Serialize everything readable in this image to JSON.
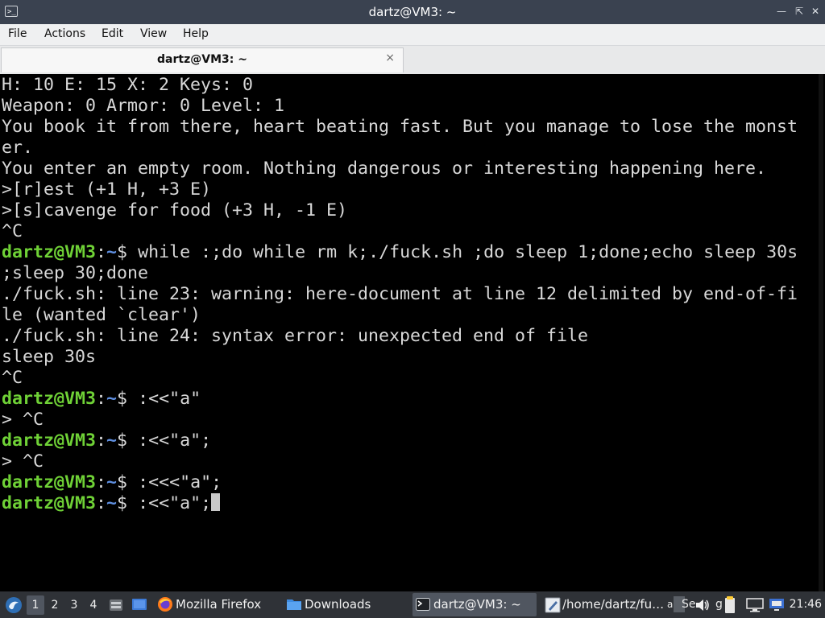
{
  "window": {
    "title": "dartz@VM3: ~"
  },
  "menu": [
    "File",
    "Actions",
    "Edit",
    "View",
    "Help"
  ],
  "tab": {
    "label": "dartz@VM3: ~",
    "close": "×"
  },
  "prompt": {
    "user": "dartz@VM3",
    "sep": ":",
    "path": "~",
    "sym": "$ "
  },
  "terminal": {
    "pre": [
      "H: 10 E: 15 X: 2 Keys: 0",
      "Weapon: 0 Armor: 0 Level: 1",
      "You book it from there, heart beating fast. But you manage to lose the monst",
      "er.",
      "You enter an empty room. Nothing dangerous or interesting happening here.",
      ">[r]est (+1 H, +3 E)",
      ">[s]cavenge for food (+3 H, -1 E)",
      "^C"
    ],
    "cmd1": "while :;do while rm k;./fuck.sh ;do sleep 1;done;echo sleep 30s",
    "mid": [
      ";sleep 30;done",
      "./fuck.sh: line 23: warning: here-document at line 12 delimited by end-of-fi",
      "le (wanted `clear')",
      "./fuck.sh: line 24: syntax error: unexpected end of file",
      "sleep 30s",
      "^C"
    ],
    "cmd2": ":<<\"a\"",
    "out2": "> ^C",
    "cmd3": ":<<\"a\";",
    "out3": "> ^C",
    "cmd4": ":<<<\"a\";",
    "cmd5": ":<<\"a\";"
  },
  "taskbar": {
    "workspaces": [
      "1",
      "2",
      "3",
      "4"
    ],
    "tasks": [
      {
        "label": "Mozilla Firefox"
      },
      {
        "label": "Downloads"
      },
      {
        "label": "dartz@VM3: ~"
      },
      {
        "label": "/home/dartz/fu…"
      }
    ],
    "tray_text": [
      "a",
      "Se",
      "g"
    ],
    "clock": "21:46"
  },
  "colors": {
    "prompt_user": "#6fd136",
    "prompt_path": "#5f8fe0",
    "taskbar": "#2f3237"
  }
}
